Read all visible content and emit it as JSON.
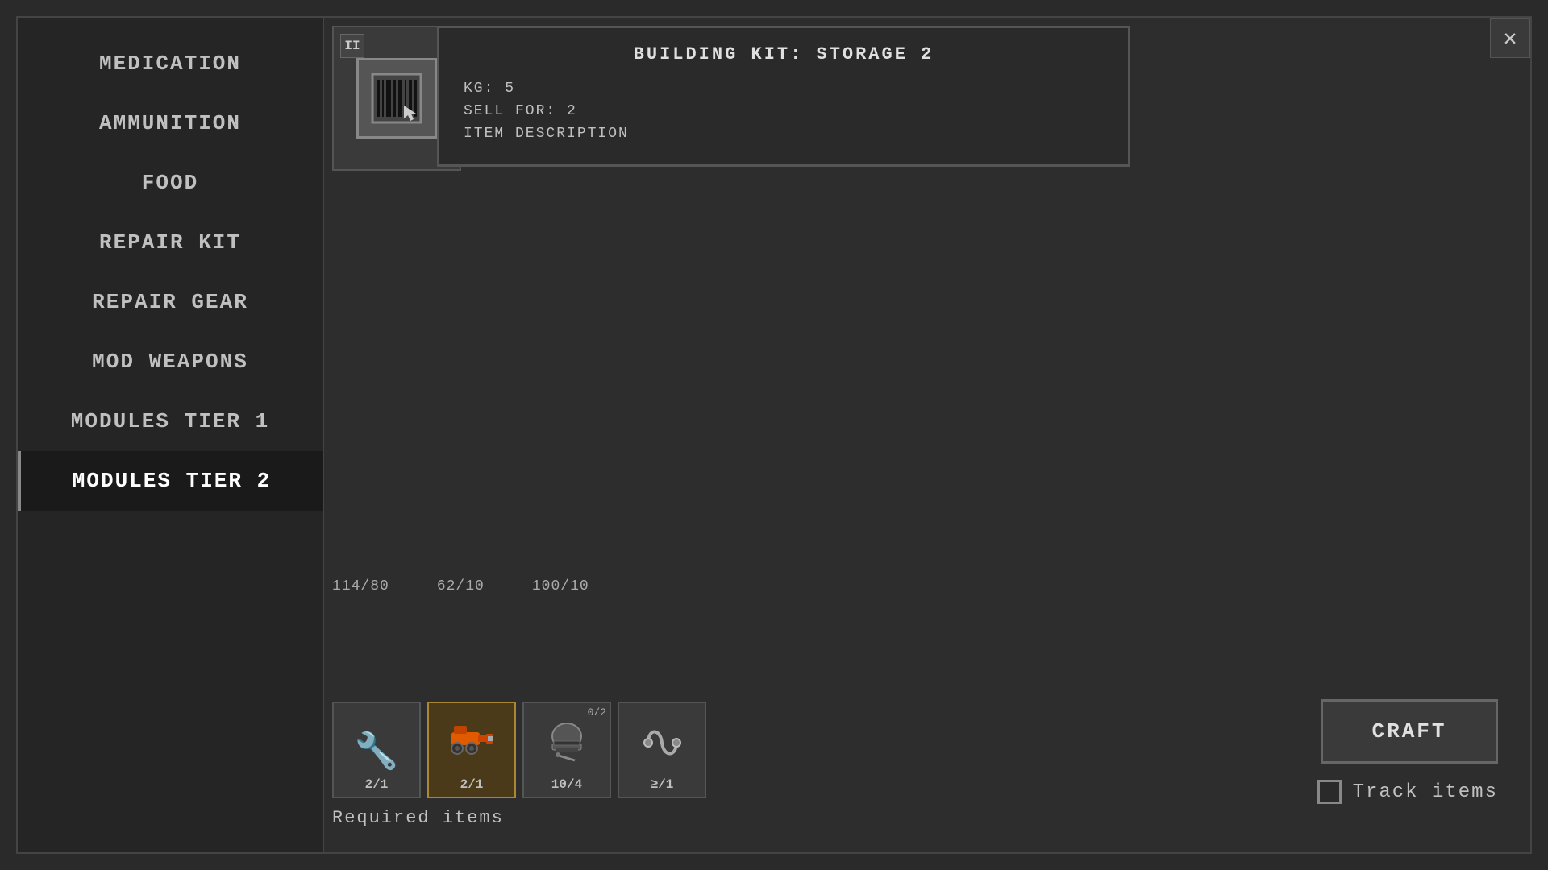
{
  "window": {
    "close_button": "✕"
  },
  "sidebar": {
    "items": [
      {
        "id": "medication",
        "label": "Medication",
        "active": false
      },
      {
        "id": "ammunition",
        "label": "Ammunition",
        "active": false
      },
      {
        "id": "food",
        "label": "Food",
        "active": false
      },
      {
        "id": "repair-kit",
        "label": "Repair kit",
        "active": false
      },
      {
        "id": "repair-gear",
        "label": "Repair gear",
        "active": false
      },
      {
        "id": "mod-weapons",
        "label": "Mod weapons",
        "active": false
      },
      {
        "id": "modules-tier-1",
        "label": "Modules Tier 1",
        "active": false
      },
      {
        "id": "modules-tier-2",
        "label": "Modules Tier 2",
        "active": true
      }
    ]
  },
  "item": {
    "tier": "II",
    "tooltip": {
      "title": "BUILDING KIT: STORAGE 2",
      "kg_label": "KG: 5",
      "sell_label": "SELL FOR: 2",
      "description_label": "ITEM DESCRIPTION"
    }
  },
  "stats": {
    "weight": "114/80",
    "capacity1": "62/10",
    "capacity2": "100/10"
  },
  "required": {
    "label": "Required items",
    "ingredients": [
      {
        "id": "wrench",
        "icon": "🔧",
        "count": "2/1",
        "highlighted": false
      },
      {
        "id": "drill",
        "icon": "🔩",
        "count": "2/1",
        "highlighted": true
      },
      {
        "id": "helmet",
        "icon": "⚙",
        "count_top": "0/2",
        "count_bottom": "10/4",
        "highlighted": false
      },
      {
        "id": "wire",
        "icon": "🔗",
        "count": "≥/1",
        "highlighted": false
      }
    ]
  },
  "actions": {
    "craft_label": "Craft",
    "track_label": "Track items"
  }
}
